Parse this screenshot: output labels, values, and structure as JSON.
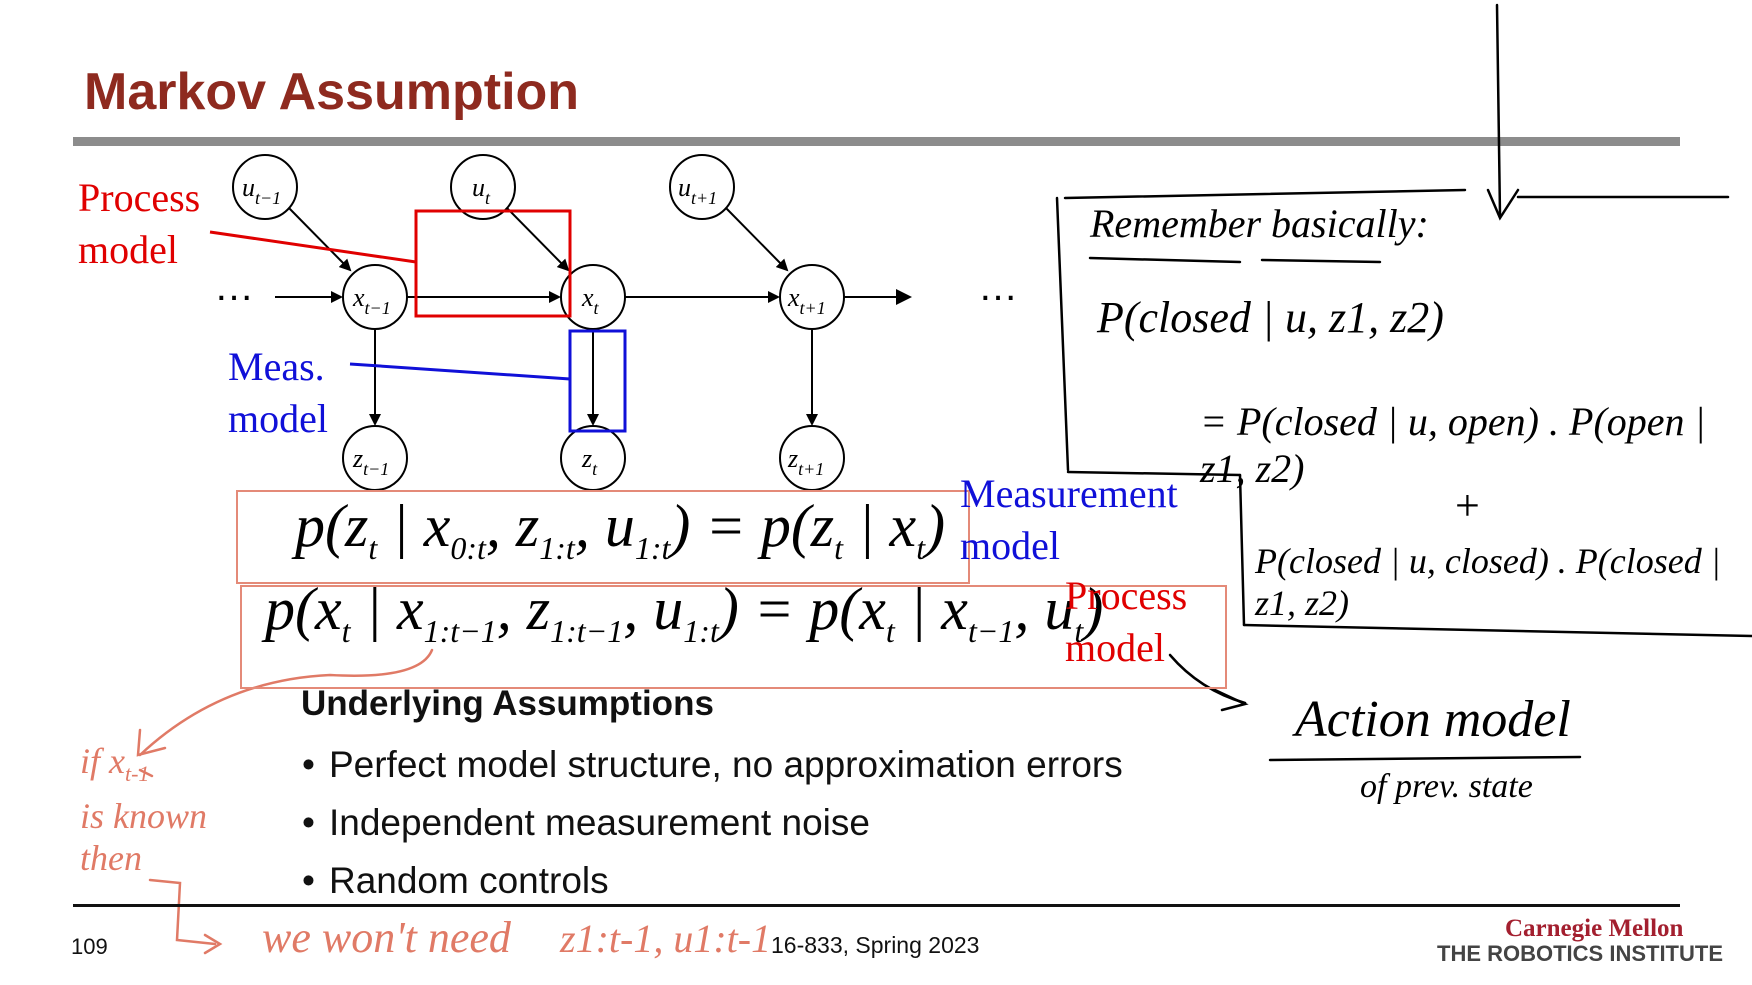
{
  "slide": {
    "title": "Markov Assumption",
    "page_number": "109",
    "course": "16-833, Spring 2023",
    "logo_top": "Carnegie Mellon",
    "logo_bottom": "THE ROBOTICS INSTITUTE"
  },
  "diagram": {
    "process_label": [
      "Process",
      "model"
    ],
    "meas_label": [
      "Meas.",
      "model"
    ],
    "ellipsis_left": "…",
    "ellipsis_right": "…",
    "nodes": {
      "u_prev": "u",
      "u_prev_sub": "t−1",
      "u_cur": "u",
      "u_cur_sub": "t",
      "u_next": "u",
      "u_next_sub": "t+1",
      "x_prev": "x",
      "x_prev_sub": "t−1",
      "x_cur": "x",
      "x_cur_sub": "t",
      "x_next": "x",
      "x_next_sub": "t+1",
      "z_prev": "z",
      "z_prev_sub": "t−1",
      "z_cur": "z",
      "z_cur_sub": "t",
      "z_next": "z",
      "z_next_sub": "t+1"
    }
  },
  "equations": {
    "measurement": {
      "lhs": "p(z",
      "lhs_sub": "t",
      "given": " | x",
      "given_sub": "0:t",
      "mid1": ", z",
      "mid1_sub": "1:t",
      "mid2": ", u",
      "mid2_sub": "1:t",
      "close": ")  =  p(z",
      "rhs_sub": "t",
      "rhs_given": " | x",
      "rhs_given_sub": "t",
      "end": ")",
      "label": [
        "Measurement",
        "model"
      ]
    },
    "process": {
      "lhs": "p(x",
      "lhs_sub": "t",
      "given": " | x",
      "given_sub": "1:t−1",
      "mid1": ", z",
      "mid1_sub": "1:t−1",
      "mid2": ", u",
      "mid2_sub": "1:t",
      "close": ")  =  p(x",
      "rhs_sub": "t",
      "rhs_given": " | x",
      "rhs_given_sub": "t−1",
      "rhs_mid": ", u",
      "rhs_mid_sub": "t",
      "end": ")",
      "label": [
        "Process",
        "model"
      ]
    }
  },
  "assumptions": {
    "heading": "Underlying Assumptions",
    "items": [
      "Perfect model structure, no approximation errors",
      "Independent measurement noise",
      "Random controls"
    ]
  },
  "handwritten_notes": {
    "box_heading": "Remember basically:",
    "line1": "P(closed | u, z1, z2)",
    "line2": "= P(closed | u, open) . P(open | z1, z2)",
    "plus": "+",
    "line3": "P(closed | u, closed) . P(closed | z1, z2)",
    "action_model": "Action model",
    "action_sub": "of prev. state",
    "left_note": [
      "if x",
      "t-1",
      "is known",
      "then"
    ],
    "bottom_note": "we won't need",
    "bottom_expr": "z1:t-1, u1:t-1"
  },
  "colors": {
    "title": "#8e2a1f",
    "process": "#e00000",
    "measurement": "#1010d8",
    "annotation_ink": "#e07a66",
    "rule": "#8c8c8c"
  }
}
